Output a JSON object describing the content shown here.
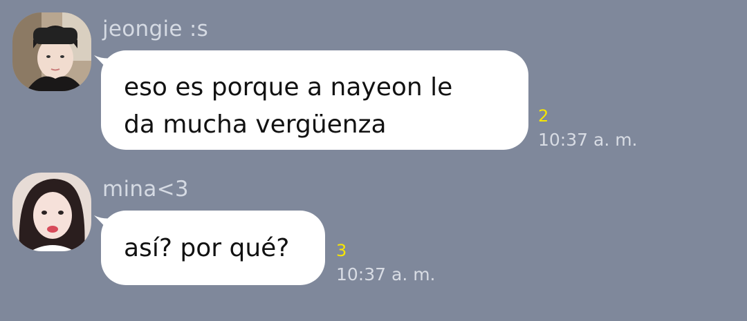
{
  "chat": {
    "background_color": "#7f889b",
    "messages": [
      {
        "sender": "jeongie :s",
        "avatar_icon": "profile-photo-jeongie",
        "text_lines": [
          "eso es porque a nayeon le",
          "da mucha vergüenza"
        ],
        "unread_count": "2",
        "time": "10:37 a. m."
      },
      {
        "sender": "mina<3",
        "avatar_icon": "profile-photo-mina",
        "text_lines": [
          "así? por qué?"
        ],
        "unread_count": "3",
        "time": "10:37 a. m."
      }
    ]
  }
}
